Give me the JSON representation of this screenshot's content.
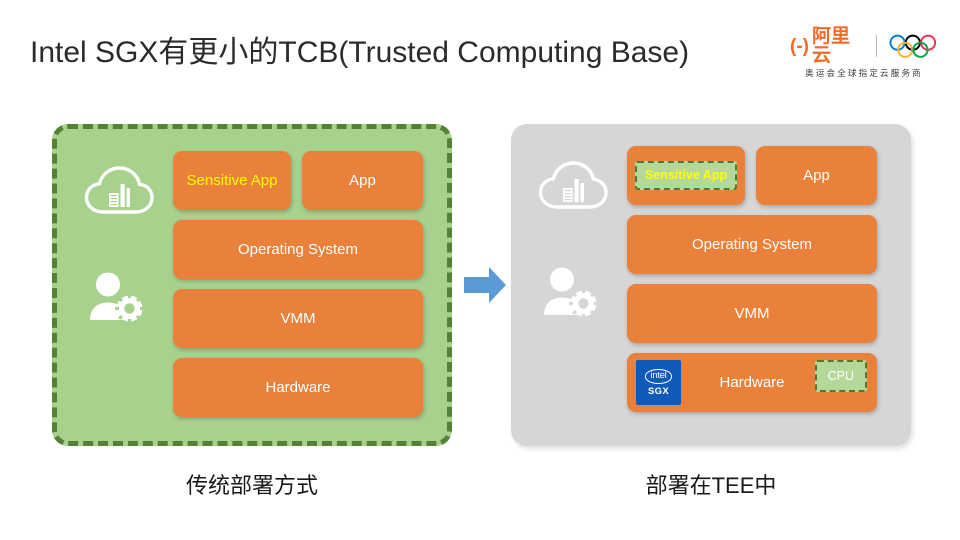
{
  "slide": {
    "title": "Intel SGX有更小的TCB(Trusted Computing Base)"
  },
  "brand": {
    "bracket_left": "(-)",
    "name_cn": "阿里云",
    "tagline": "奥运会全球指定云服务商",
    "accent_color": "#ef6c28",
    "rings_colors": [
      "#0081c8",
      "#000000",
      "#ee334e",
      "#fcb131",
      "#00a651"
    ]
  },
  "panels": [
    {
      "id": "traditional",
      "caption": "传统部署方式",
      "background_color": "#a9d18e",
      "border_color": "#548235",
      "border_style": "dashed",
      "icons": [
        "cloud-building-icon",
        "user-gear-icon"
      ],
      "layers": [
        {
          "label": "Sensitive App",
          "text_color": "#ffff00",
          "highlighted": false
        },
        {
          "label": "App",
          "text_color": "#ffffff",
          "highlighted": false
        },
        {
          "label": "Operating System",
          "text_color": "#ffffff",
          "highlighted": false
        },
        {
          "label": "VMM",
          "text_color": "#ffffff",
          "highlighted": false
        },
        {
          "label": "Hardware",
          "text_color": "#ffffff",
          "highlighted": false
        }
      ]
    },
    {
      "id": "tee",
      "caption": "部署在TEE中",
      "background_color": "#d6d6d6",
      "border_color": "none",
      "border_style": "none",
      "icons": [
        "cloud-building-icon",
        "user-gear-icon"
      ],
      "layers": [
        {
          "label": "Sensitive App",
          "text_color": "#ffff00",
          "highlighted": true
        },
        {
          "label": "App",
          "text_color": "#ffffff",
          "highlighted": false
        },
        {
          "label": "Operating System",
          "text_color": "#ffffff",
          "highlighted": false
        },
        {
          "label": "VMM",
          "text_color": "#ffffff",
          "highlighted": false
        },
        {
          "label": "Hardware",
          "text_color": "#ffffff",
          "highlighted": false
        }
      ],
      "hardware_badges": {
        "intel_brand": "intel",
        "intel_product": "SGX",
        "intel_badge_color": "#0f5ab8",
        "cpu_label": "CPU",
        "cpu_chip_color": "#b4d79a",
        "cpu_chip_border": "#4e7c2e"
      }
    }
  ],
  "arrow": {
    "direction": "right",
    "color": "#5b9bd5"
  },
  "colors": {
    "layer_orange": "#e9813b",
    "panel_green": "#a9d18e",
    "panel_gray": "#d6d6d6",
    "enclave_green": "#b4d79a",
    "enclave_border": "#4e7c2e",
    "highlight_yellow": "#ffff00"
  }
}
